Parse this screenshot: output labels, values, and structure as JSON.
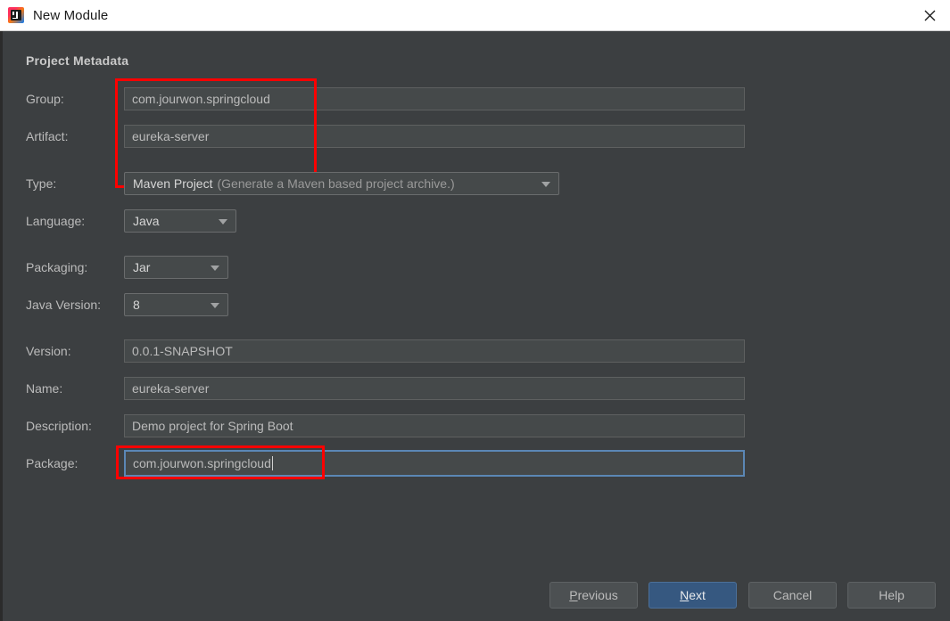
{
  "window": {
    "title": "New Module",
    "icon": "intellij-idea-icon",
    "close_label": "×"
  },
  "section": {
    "title": "Project Metadata"
  },
  "form": {
    "fields": [
      {
        "label": "Group:",
        "value": "com.jourwon.springcloud",
        "type": "text",
        "highlighted": true,
        "focused": false
      },
      {
        "label": "Artifact:",
        "value": "eureka-server",
        "type": "text",
        "highlighted": true,
        "focused": false
      },
      {
        "label": "Type:",
        "value": "Maven Project",
        "sub": "(Generate a Maven based project archive.)",
        "type": "combo"
      },
      {
        "label": "Language:",
        "value": "Java",
        "type": "combo"
      },
      {
        "label": "Packaging:",
        "value": "Jar",
        "type": "combo"
      },
      {
        "label": "Java Version:",
        "value": "8",
        "type": "combo"
      },
      {
        "label": "Version:",
        "value": "0.0.1-SNAPSHOT",
        "type": "text",
        "highlighted": false,
        "focused": false
      },
      {
        "label": "Name:",
        "value": "eureka-server",
        "type": "text",
        "highlighted": false,
        "focused": false
      },
      {
        "label": "Description:",
        "value": "Demo project for Spring Boot",
        "type": "text",
        "highlighted": false,
        "focused": false
      },
      {
        "label": "Package:",
        "value": "com.jourwon.springcloud",
        "type": "text",
        "highlighted": true,
        "focused": true
      }
    ]
  },
  "footer": {
    "buttons": [
      {
        "label": "Previous",
        "mnemonic": "P",
        "primary": false
      },
      {
        "label": "Next",
        "mnemonic": "N",
        "primary": true
      },
      {
        "label": "Cancel",
        "mnemonic": "",
        "primary": false
      },
      {
        "label": "Help",
        "mnemonic": "",
        "primary": false
      }
    ]
  },
  "colors": {
    "dialog_bg": "#3c3f41",
    "field_bg": "#45494a",
    "titlebar_bg": "#ffffff",
    "accent_blue": "#365880",
    "focus_blue": "#5b87b5",
    "annotation_red": "#fe0000",
    "label_text": "#bbbbbb"
  }
}
